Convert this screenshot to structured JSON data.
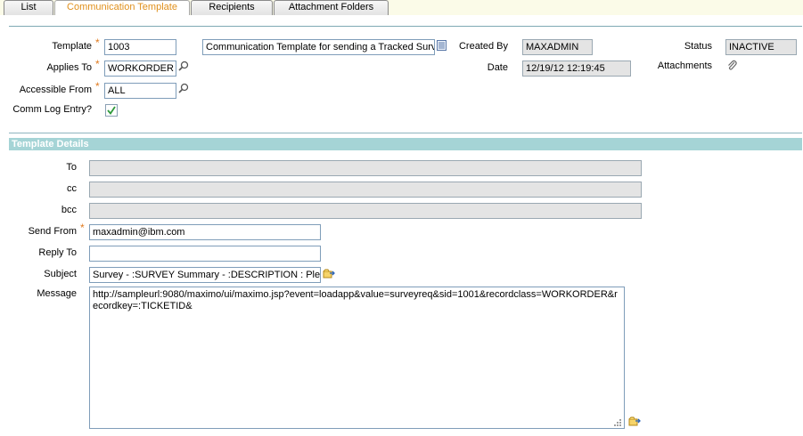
{
  "tabs": [
    {
      "label": "List"
    },
    {
      "label": "Communication Template"
    },
    {
      "label": "Recipients"
    },
    {
      "label": "Attachment Folders"
    }
  ],
  "header": {
    "template_label": "Template",
    "template_value": "1003",
    "description_value": "Communication Template for sending a Tracked Surve",
    "applies_to_label": "Applies To",
    "applies_to_value": "WORKORDER",
    "accessible_from_label": "Accessible From",
    "accessible_from_value": "ALL",
    "comm_log_label": "Comm Log Entry?",
    "comm_log_checked": true,
    "created_by_label": "Created By",
    "created_by_value": "MAXADMIN",
    "date_label": "Date",
    "date_value": "12/19/12 12:19:45",
    "status_label": "Status",
    "status_value": "INACTIVE",
    "attachments_label": "Attachments"
  },
  "details": {
    "section_title": "Template Details",
    "to_label": "To",
    "to_value": "",
    "cc_label": "cc",
    "cc_value": "",
    "bcc_label": "bcc",
    "bcc_value": "",
    "send_from_label": "Send From",
    "send_from_value": "maxadmin@ibm.com",
    "reply_to_label": "Reply To",
    "reply_to_value": "",
    "subject_label": "Subject",
    "subject_value": "Survey - :SURVEY   Summary - :DESCRIPTION : Pleas",
    "message_label": "Message",
    "message_value": "http://sampleurl:9080/maximo/ui/maximo.jsp?event=loadapp&value=surveyreq&sid=1001&recordclass=WORKORDER&recordkey=:TICKETID&"
  },
  "colors": {
    "accent": "#e0901c",
    "section_header": "#a5d4d6",
    "required": "#e07b20",
    "readonly_bg": "#e4e4e4"
  }
}
